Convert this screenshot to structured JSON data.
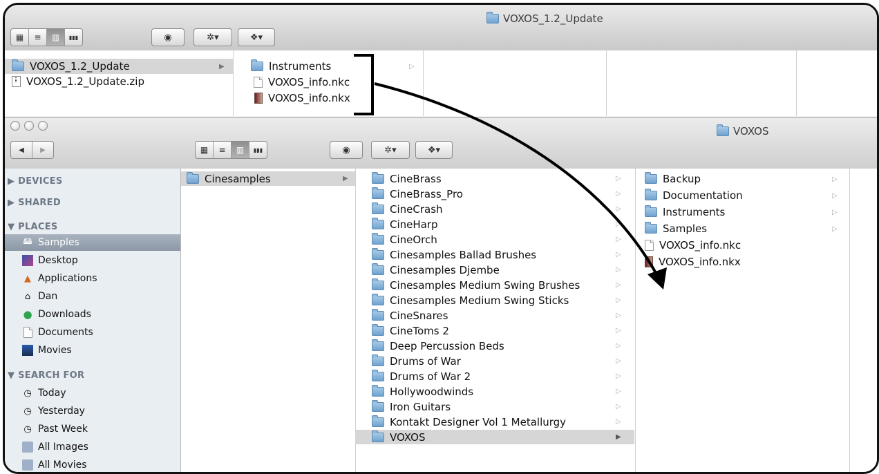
{
  "back_window": {
    "title": "VOXOS_1.2_Update",
    "col1": [
      {
        "label": "VOXOS_1.2_Update",
        "icon": "folder-icon",
        "selected": true,
        "has_children": true
      },
      {
        "label": "VOXOS_1.2_Update.zip",
        "icon": "zip-icon",
        "selected": false,
        "has_children": false
      }
    ],
    "col2": [
      {
        "label": "Instruments",
        "icon": "folder-icon",
        "has_children": true
      },
      {
        "label": "VOXOS_info.nkc",
        "icon": "document-icon",
        "has_children": false
      },
      {
        "label": "VOXOS_info.nkx",
        "icon": "nkx-icon",
        "has_children": false
      }
    ]
  },
  "front_window": {
    "title": "VOXOS",
    "nav": {
      "back": "◀",
      "forward": "▶"
    },
    "sidebar": {
      "devices": "▶ DEVICES",
      "shared": "▶ SHARED",
      "places": "▼ PLACES",
      "places_items": [
        {
          "label": "Samples",
          "icon": "hard-drive-icon",
          "selected": true
        },
        {
          "label": "Desktop",
          "icon": "desktop-icon"
        },
        {
          "label": "Applications",
          "icon": "applications-icon"
        },
        {
          "label": "Dan",
          "icon": "home-icon"
        },
        {
          "label": "Downloads",
          "icon": "downloads-icon"
        },
        {
          "label": "Documents",
          "icon": "documents-icon"
        },
        {
          "label": "Movies",
          "icon": "movies-icon"
        }
      ],
      "search_for": "▼ SEARCH FOR",
      "search_items": [
        {
          "label": "Today",
          "icon": "clock-icon"
        },
        {
          "label": "Yesterday",
          "icon": "clock-icon"
        },
        {
          "label": "Past Week",
          "icon": "clock-icon"
        },
        {
          "label": "All Images",
          "icon": "smart-folder-icon"
        },
        {
          "label": "All Movies",
          "icon": "smart-folder-icon"
        }
      ]
    },
    "col1": [
      {
        "label": "Cinesamples",
        "selected": true
      }
    ],
    "col2": [
      "CineBrass",
      "CineBrass_Pro",
      "CineCrash",
      "CineHarp",
      "CineOrch",
      "Cinesamples Ballad Brushes",
      "Cinesamples Djembe",
      "Cinesamples Medium Swing Brushes",
      "Cinesamples Medium Swing Sticks",
      "CineSnares",
      "CineToms 2",
      "Deep Percussion Beds",
      "Drums of War",
      "Drums of War 2",
      "Hollywoodwinds",
      "Iron Guitars",
      "Kontakt Designer Vol 1 Metallurgy",
      "VOXOS"
    ],
    "col2_selected": "VOXOS",
    "col3": [
      {
        "label": "Backup",
        "icon": "folder-icon",
        "has_children": true
      },
      {
        "label": "Documentation",
        "icon": "folder-icon",
        "has_children": true
      },
      {
        "label": "Instruments",
        "icon": "folder-icon",
        "has_children": true
      },
      {
        "label": "Samples",
        "icon": "folder-icon",
        "has_children": true
      },
      {
        "label": "VOXOS_info.nkc",
        "icon": "document-icon",
        "has_children": false
      },
      {
        "label": "VOXOS_info.nkx",
        "icon": "nkx-icon",
        "has_children": false
      }
    ]
  },
  "toolbar": {
    "view_icons": "▦",
    "view_list": "≡",
    "view_columns": "▥",
    "view_coverflow": "▮▮▮",
    "quicklook": "👁",
    "action": "✲▾",
    "dropbox": "❖▾"
  },
  "annotation": {
    "description_icon": "curved-arrow-annotation"
  }
}
